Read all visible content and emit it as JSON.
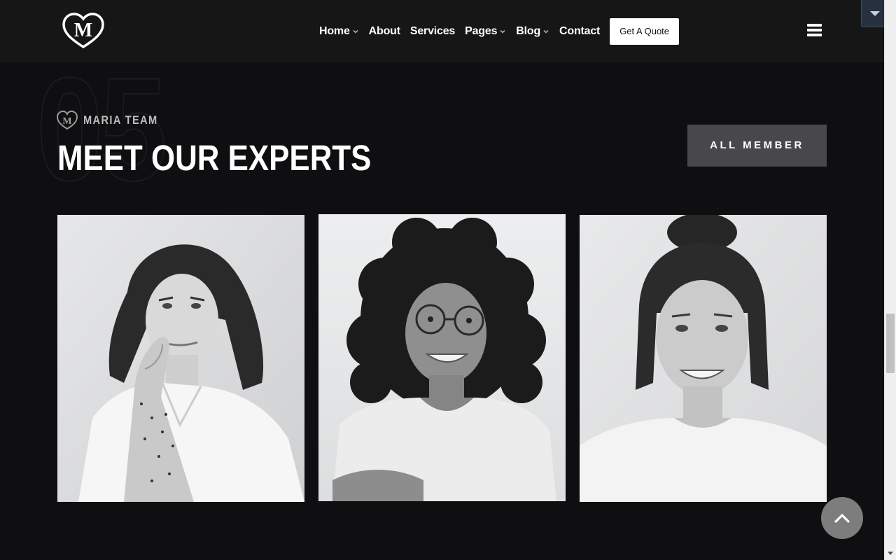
{
  "header": {
    "logo_alt": "M",
    "nav": [
      {
        "label": "Home",
        "has_dropdown": true
      },
      {
        "label": "About",
        "has_dropdown": false
      },
      {
        "label": "Services",
        "has_dropdown": false
      },
      {
        "label": "Pages",
        "has_dropdown": true
      },
      {
        "label": "Blog",
        "has_dropdown": true
      },
      {
        "label": "Contact",
        "has_dropdown": false
      }
    ],
    "quote_button": "Get A Quote",
    "menu_icon": "hamburger-icon"
  },
  "section": {
    "number": "05",
    "subtitle": "MARIA TEAM",
    "title": "MEET OUR EXPERTS",
    "all_button": "ALL MEMBER"
  },
  "team": [
    {
      "photo": "team-member-1-photo"
    },
    {
      "photo": "team-member-2-photo"
    },
    {
      "photo": "team-member-3-photo"
    }
  ],
  "colors": {
    "background": "#0f0f11",
    "header": "#161616",
    "button_dark": "#48484c",
    "scroll_top": "#7d7d7d"
  }
}
